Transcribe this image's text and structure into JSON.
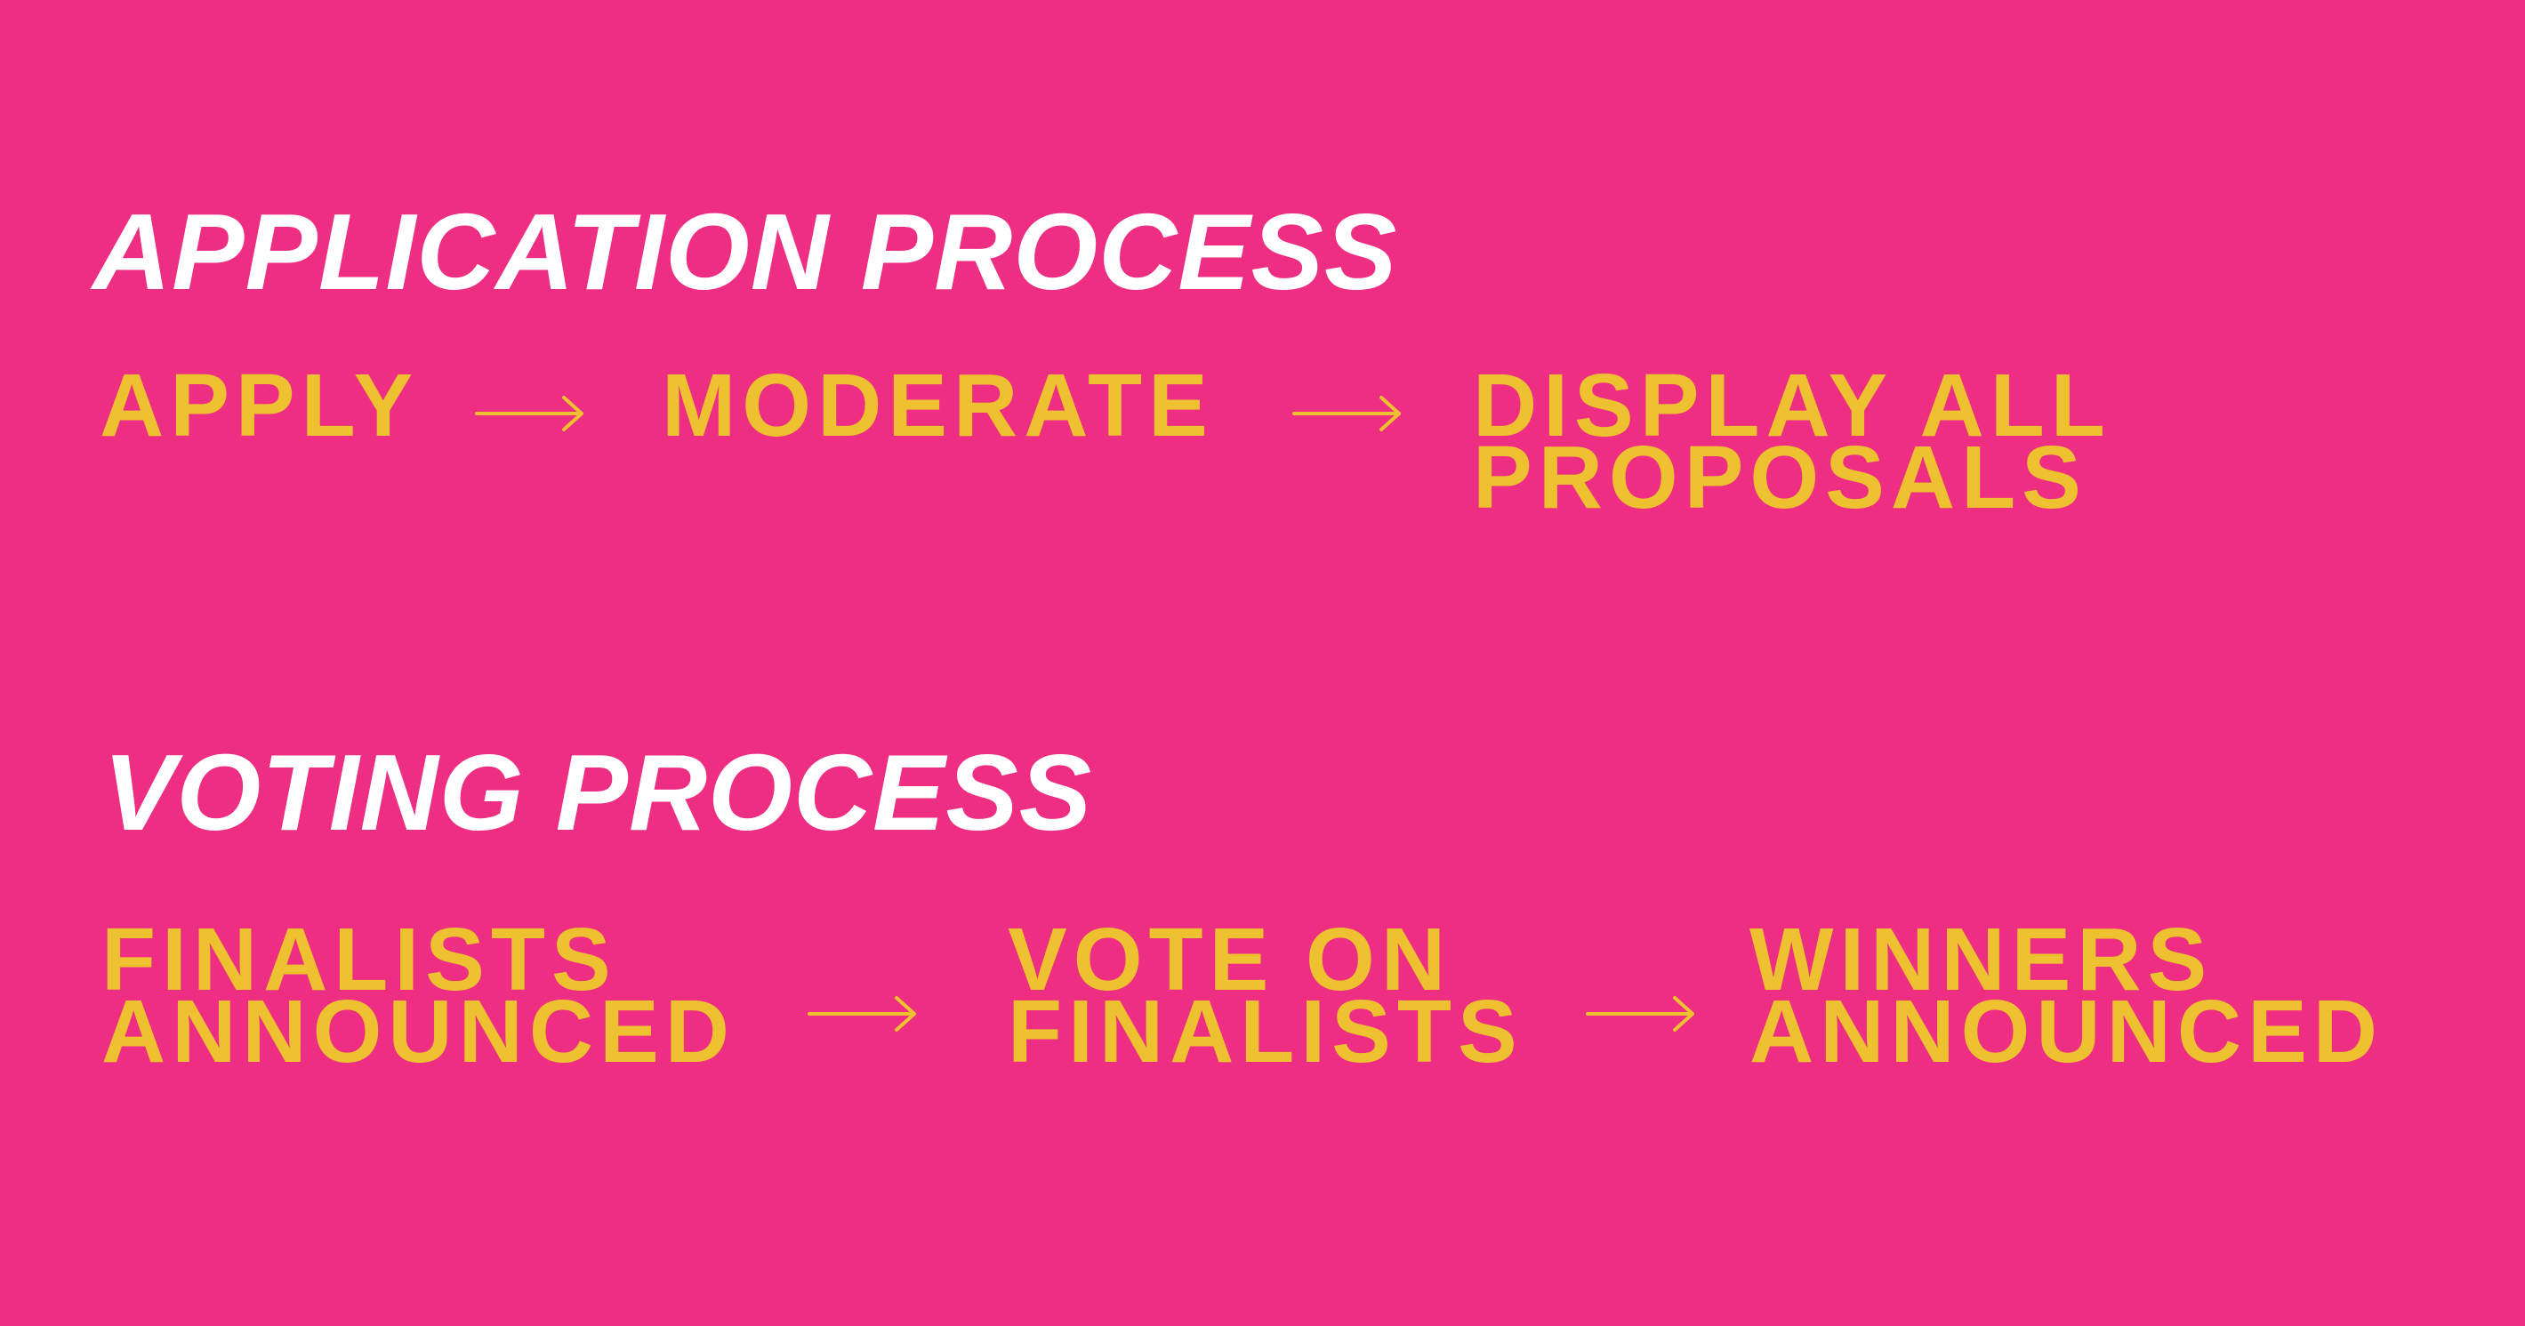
{
  "colors": {
    "background": "#EE2E82",
    "heading": "#FFFFFF",
    "step": "#EDC12F"
  },
  "application": {
    "title": "APPLICATION PROCESS",
    "steps": [
      {
        "lines": [
          "APPLY"
        ]
      },
      {
        "lines": [
          "MODERATE"
        ]
      },
      {
        "lines": [
          "DISPLAY ALL",
          "PROPOSALS"
        ]
      }
    ]
  },
  "voting": {
    "title": "VOTING PROCESS",
    "steps": [
      {
        "lines": [
          "FINALISTS",
          "ANNOUNCED"
        ]
      },
      {
        "lines": [
          "VOTE ON",
          "FINALISTS"
        ]
      },
      {
        "lines": [
          "WINNERS",
          "ANNOUNCED"
        ]
      }
    ]
  }
}
